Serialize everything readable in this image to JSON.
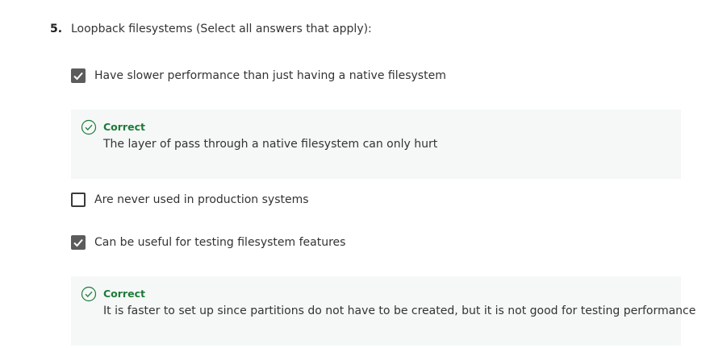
{
  "question": {
    "number": "5.",
    "text": "Loopback filesystems (Select all answers that apply):"
  },
  "options": [
    {
      "label": "Have slower performance than just having a native filesystem",
      "checked": true,
      "feedback": {
        "status": "Correct",
        "text": "The layer of pass through a native filesystem can only hurt"
      }
    },
    {
      "label": "Are never used in production systems",
      "checked": false
    },
    {
      "label": "Can be useful for testing filesystem features",
      "checked": true,
      "feedback": {
        "status": "Correct",
        "text": "It is faster to set up since partitions do not have to be created, but it is not good for testing performance"
      }
    }
  ],
  "colors": {
    "correct": "#1e7a3a",
    "checked_box": "#5c5c5c",
    "feedback_bg": "#f5f8f7"
  },
  "icons": {
    "checkmark": "check-icon",
    "correct": "correct-circle-icon"
  }
}
